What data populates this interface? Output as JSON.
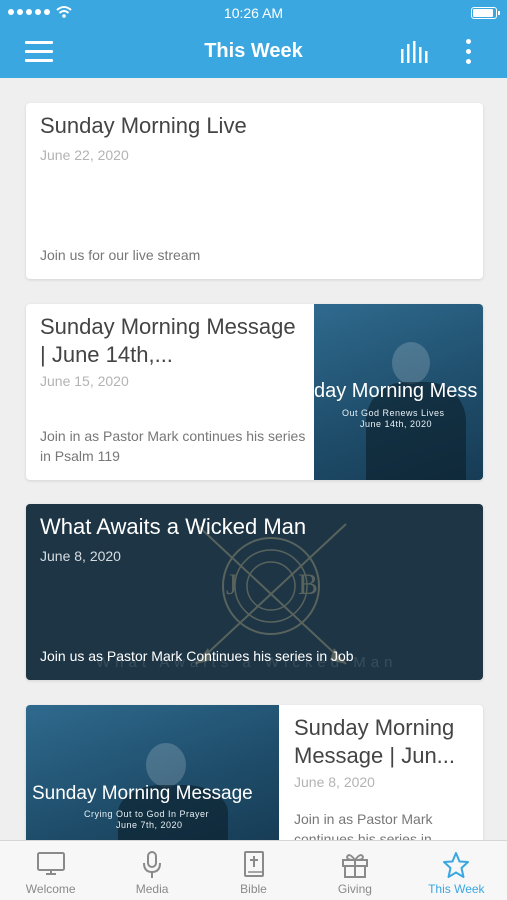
{
  "status_bar": {
    "time": "10:26 AM"
  },
  "app_bar": {
    "title": "This Week"
  },
  "cards": [
    {
      "title": "Sunday Morning Live",
      "date": "June 22, 2020",
      "description": "Join us for our live stream"
    },
    {
      "title": "Sunday Morning Message |  June 14th,...",
      "date": "June 15, 2020",
      "description": "Join in as Pastor Mark continues his series in Psalm 119",
      "thumb_title": "day Morning Mess",
      "thumb_subtitle_1": "Out God Renews Lives",
      "thumb_subtitle_2": "June 14th, 2020"
    },
    {
      "title": "What Awaits a Wicked Man",
      "date": "June 8, 2020",
      "description": "Join us as Pastor Mark Continues his series in Job",
      "emblem_text_left": "J",
      "emblem_text_right": "B",
      "background_caption": "What Awaits a Wicked Man"
    },
    {
      "title": "Sunday Morning Message |  Jun...",
      "date": "June 8, 2020",
      "description": "Join in as Pastor Mark continues his series in",
      "thumb_title": "Sunday Morning Message",
      "thumb_subtitle_1": "Crying Out to God In Prayer",
      "thumb_subtitle_2": "June 7th, 2020"
    }
  ],
  "tabs": [
    {
      "label": "Welcome",
      "icon": "monitor-icon",
      "active": false
    },
    {
      "label": "Media",
      "icon": "microphone-icon",
      "active": false
    },
    {
      "label": "Bible",
      "icon": "bible-icon",
      "active": false
    },
    {
      "label": "Giving",
      "icon": "gift-icon",
      "active": false
    },
    {
      "label": "This Week",
      "icon": "star-icon",
      "active": true
    }
  ],
  "colors": {
    "primary": "#3aa7e0",
    "dark_card": "#1d3545",
    "tab_inactive": "#8a8a8a"
  }
}
